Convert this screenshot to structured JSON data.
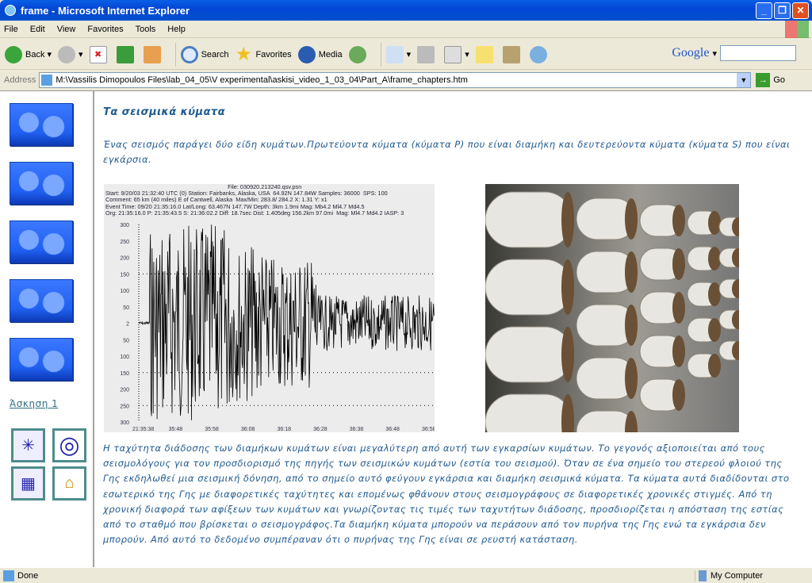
{
  "window": {
    "title": "frame - Microsoft Internet Explorer"
  },
  "menu": [
    "File",
    "Edit",
    "View",
    "Favorites",
    "Tools",
    "Help"
  ],
  "toolbar": {
    "back": "Back",
    "search": "Search",
    "favorites": "Favorites",
    "media": "Media",
    "google": "Google"
  },
  "address": {
    "label": "Address",
    "value": "M:\\Vassilis Dimopoulos Files\\lab_04_05\\V experimental\\askisi_video_1_03_04\\Part_A\\frame_chapters.htm",
    "go": "Go"
  },
  "sidebar": {
    "exercise_link": "Άσκηση 1"
  },
  "page": {
    "heading": "Τα σεισμικά κύματα",
    "intro": "Ένας σεισμός παράγει δύο είδη κυμάτων.Πρωτεύοντα κύματα (κύματα P) που είναι διαμήκη και δευτερεύοντα κύματα (κύματα S) που είναι εγκάρσια.",
    "body": "Η ταχύτητα διάδοσης των διαμήκων κυμάτων είναι μεγαλύτερη από αυτή των εγκαρσίων κυμάτων. Το γεγονός αξιοποιείται από τους σεισμολόγους για τον προσδιορισμό της πηγής των σεισμικών κυμάτων (εστία του σεισμού). Όταν σε ένα σημείο του στερεού φλοιού της Γης εκδηλωθεί μια σεισμική δόνηση, από το σημείο αυτό φεύγουν εγκάρσια και διαμήκη σεισμικά κύματα. Τα κύματα αυτά διαδίδονται στο εσωτερικό της Γης με διαφορετικές ταχύτητες και επομένως φθάνουν στους σεισμογράφους σε διαφορετικές χρονικές στιγμές. Από τη χρονική διαφορά των αφίξεων των κυμάτων και γνωρίζοντας τις τιμές των ταχυτήτων διάδοσης, προσδιορίζεται η απόσταση της εστίας από το σταθμό που βρίσκεται ο σεισμογράφος.Τα διαμήκη κύματα μπορούν να περάσουν από τον πυρήνα της Γης ενώ τα εγκάρσια δεν μπορούν. Από αυτό το δεδομένο συμπέραναν ότι ο πυρήνας της Γης είναι σε ρευστή κατάσταση."
  },
  "seismogram": {
    "header": "                                                                            File: 030920.213240.qsv.psn\nStart: 9/20/03 21:32:40 UTC (0) Station: Fairbanks, Alaska, USA  64.92N 147.84W Samples: 36000  SPS: 100\nComment: 65 km (40 miles) E of Cantwell, Alaska  Max/Min: 283.8/ 284.2 X: 1.31 Y: x1\nEvent Time: 09/20 21:35:16.0 Lat/Long: 63.467N 147.7W Depth: 3km 1.9mi Mag: Mb4.2 Ml4.7 Md4.5\nOrg: 21:35:16.0 P: 21:35:43.5 S: 21:36:02.2 Diff: 18.7sec Dist: 1.405deg 156.2km 97.0mi  Mag: Ml4.7 Md4.2 IASP: 3",
    "y_ticks": [
      "300",
      "250",
      "200",
      "150",
      "100",
      "50",
      "2",
      "50",
      "100",
      "150",
      "200",
      "250",
      "300"
    ],
    "x_ticks": [
      "21:35:38",
      "35:48",
      "35:58",
      "36:08",
      "36:18",
      "36:28",
      "36:38",
      "36:48",
      "36:58"
    ]
  },
  "status": {
    "left": "Done",
    "zone": "My Computer"
  }
}
